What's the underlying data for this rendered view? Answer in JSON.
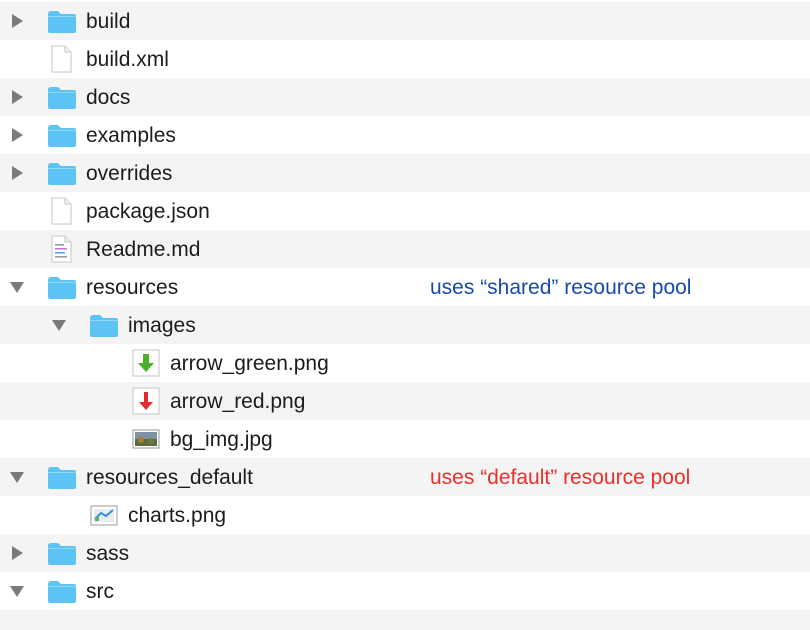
{
  "tree": {
    "rows": [
      {
        "label": "build",
        "type": "folder",
        "state": "collapsed"
      },
      {
        "label": "build.xml",
        "type": "file-blank"
      },
      {
        "label": "docs",
        "type": "folder",
        "state": "collapsed"
      },
      {
        "label": "examples",
        "type": "folder",
        "state": "collapsed"
      },
      {
        "label": "overrides",
        "type": "folder",
        "state": "collapsed"
      },
      {
        "label": "package.json",
        "type": "file-blank"
      },
      {
        "label": "Readme.md",
        "type": "file-text"
      },
      {
        "label": "resources",
        "type": "folder",
        "state": "expanded",
        "note": "uses “shared” resource pool",
        "note_color": "#1a4aa8"
      },
      {
        "label": "images",
        "type": "folder",
        "state": "expanded"
      },
      {
        "label": "arrow_green.png",
        "type": "image-arrow-green"
      },
      {
        "label": "arrow_red.png",
        "type": "image-arrow-red"
      },
      {
        "label": "bg_img.jpg",
        "type": "image-photo"
      },
      {
        "label": "resources_default",
        "type": "folder",
        "state": "expanded",
        "note": "uses “default” resource pool",
        "note_color": "#e8302b"
      },
      {
        "label": "charts.png",
        "type": "image-chart"
      },
      {
        "label": "sass",
        "type": "folder",
        "state": "collapsed"
      },
      {
        "label": "src",
        "type": "folder",
        "state": "expanded"
      }
    ]
  },
  "colors": {
    "folder": "#5cc4f4",
    "folder_tab": "#8fd6f7",
    "chevron": "#7a7a7a",
    "row_alt": "#f4f4f4"
  }
}
